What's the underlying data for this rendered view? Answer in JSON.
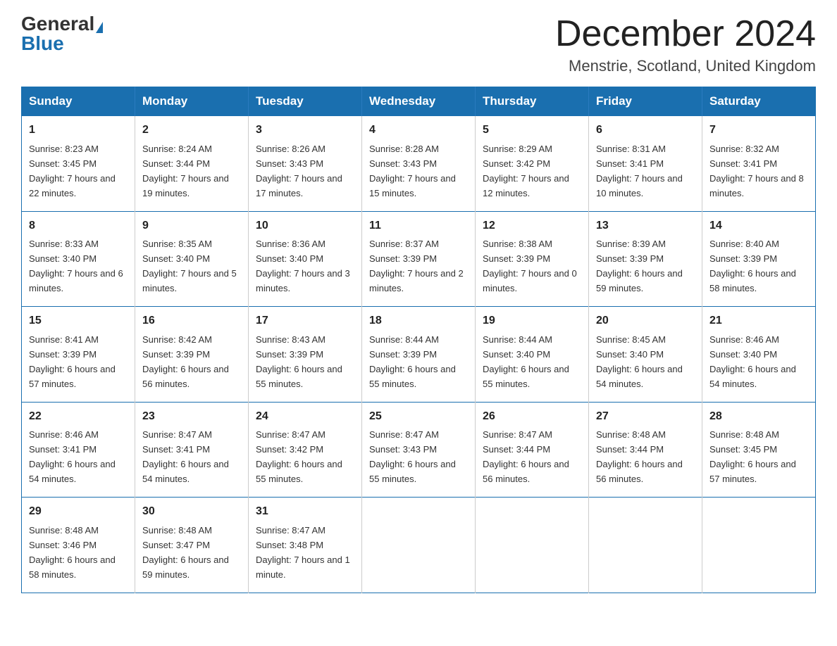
{
  "header": {
    "logo_general": "General",
    "logo_blue": "Blue",
    "month_title": "December 2024",
    "location": "Menstrie, Scotland, United Kingdom"
  },
  "weekdays": [
    "Sunday",
    "Monday",
    "Tuesday",
    "Wednesday",
    "Thursday",
    "Friday",
    "Saturday"
  ],
  "weeks": [
    [
      {
        "day": "1",
        "sunrise": "8:23 AM",
        "sunset": "3:45 PM",
        "daylight": "7 hours and 22 minutes."
      },
      {
        "day": "2",
        "sunrise": "8:24 AM",
        "sunset": "3:44 PM",
        "daylight": "7 hours and 19 minutes."
      },
      {
        "day": "3",
        "sunrise": "8:26 AM",
        "sunset": "3:43 PM",
        "daylight": "7 hours and 17 minutes."
      },
      {
        "day": "4",
        "sunrise": "8:28 AM",
        "sunset": "3:43 PM",
        "daylight": "7 hours and 15 minutes."
      },
      {
        "day": "5",
        "sunrise": "8:29 AM",
        "sunset": "3:42 PM",
        "daylight": "7 hours and 12 minutes."
      },
      {
        "day": "6",
        "sunrise": "8:31 AM",
        "sunset": "3:41 PM",
        "daylight": "7 hours and 10 minutes."
      },
      {
        "day": "7",
        "sunrise": "8:32 AM",
        "sunset": "3:41 PM",
        "daylight": "7 hours and 8 minutes."
      }
    ],
    [
      {
        "day": "8",
        "sunrise": "8:33 AM",
        "sunset": "3:40 PM",
        "daylight": "7 hours and 6 minutes."
      },
      {
        "day": "9",
        "sunrise": "8:35 AM",
        "sunset": "3:40 PM",
        "daylight": "7 hours and 5 minutes."
      },
      {
        "day": "10",
        "sunrise": "8:36 AM",
        "sunset": "3:40 PM",
        "daylight": "7 hours and 3 minutes."
      },
      {
        "day": "11",
        "sunrise": "8:37 AM",
        "sunset": "3:39 PM",
        "daylight": "7 hours and 2 minutes."
      },
      {
        "day": "12",
        "sunrise": "8:38 AM",
        "sunset": "3:39 PM",
        "daylight": "7 hours and 0 minutes."
      },
      {
        "day": "13",
        "sunrise": "8:39 AM",
        "sunset": "3:39 PM",
        "daylight": "6 hours and 59 minutes."
      },
      {
        "day": "14",
        "sunrise": "8:40 AM",
        "sunset": "3:39 PM",
        "daylight": "6 hours and 58 minutes."
      }
    ],
    [
      {
        "day": "15",
        "sunrise": "8:41 AM",
        "sunset": "3:39 PM",
        "daylight": "6 hours and 57 minutes."
      },
      {
        "day": "16",
        "sunrise": "8:42 AM",
        "sunset": "3:39 PM",
        "daylight": "6 hours and 56 minutes."
      },
      {
        "day": "17",
        "sunrise": "8:43 AM",
        "sunset": "3:39 PM",
        "daylight": "6 hours and 55 minutes."
      },
      {
        "day": "18",
        "sunrise": "8:44 AM",
        "sunset": "3:39 PM",
        "daylight": "6 hours and 55 minutes."
      },
      {
        "day": "19",
        "sunrise": "8:44 AM",
        "sunset": "3:40 PM",
        "daylight": "6 hours and 55 minutes."
      },
      {
        "day": "20",
        "sunrise": "8:45 AM",
        "sunset": "3:40 PM",
        "daylight": "6 hours and 54 minutes."
      },
      {
        "day": "21",
        "sunrise": "8:46 AM",
        "sunset": "3:40 PM",
        "daylight": "6 hours and 54 minutes."
      }
    ],
    [
      {
        "day": "22",
        "sunrise": "8:46 AM",
        "sunset": "3:41 PM",
        "daylight": "6 hours and 54 minutes."
      },
      {
        "day": "23",
        "sunrise": "8:47 AM",
        "sunset": "3:41 PM",
        "daylight": "6 hours and 54 minutes."
      },
      {
        "day": "24",
        "sunrise": "8:47 AM",
        "sunset": "3:42 PM",
        "daylight": "6 hours and 55 minutes."
      },
      {
        "day": "25",
        "sunrise": "8:47 AM",
        "sunset": "3:43 PM",
        "daylight": "6 hours and 55 minutes."
      },
      {
        "day": "26",
        "sunrise": "8:47 AM",
        "sunset": "3:44 PM",
        "daylight": "6 hours and 56 minutes."
      },
      {
        "day": "27",
        "sunrise": "8:48 AM",
        "sunset": "3:44 PM",
        "daylight": "6 hours and 56 minutes."
      },
      {
        "day": "28",
        "sunrise": "8:48 AM",
        "sunset": "3:45 PM",
        "daylight": "6 hours and 57 minutes."
      }
    ],
    [
      {
        "day": "29",
        "sunrise": "8:48 AM",
        "sunset": "3:46 PM",
        "daylight": "6 hours and 58 minutes."
      },
      {
        "day": "30",
        "sunrise": "8:48 AM",
        "sunset": "3:47 PM",
        "daylight": "6 hours and 59 minutes."
      },
      {
        "day": "31",
        "sunrise": "8:47 AM",
        "sunset": "3:48 PM",
        "daylight": "7 hours and 1 minute."
      },
      null,
      null,
      null,
      null
    ]
  ],
  "labels": {
    "sunrise": "Sunrise:",
    "sunset": "Sunset:",
    "daylight": "Daylight:"
  }
}
